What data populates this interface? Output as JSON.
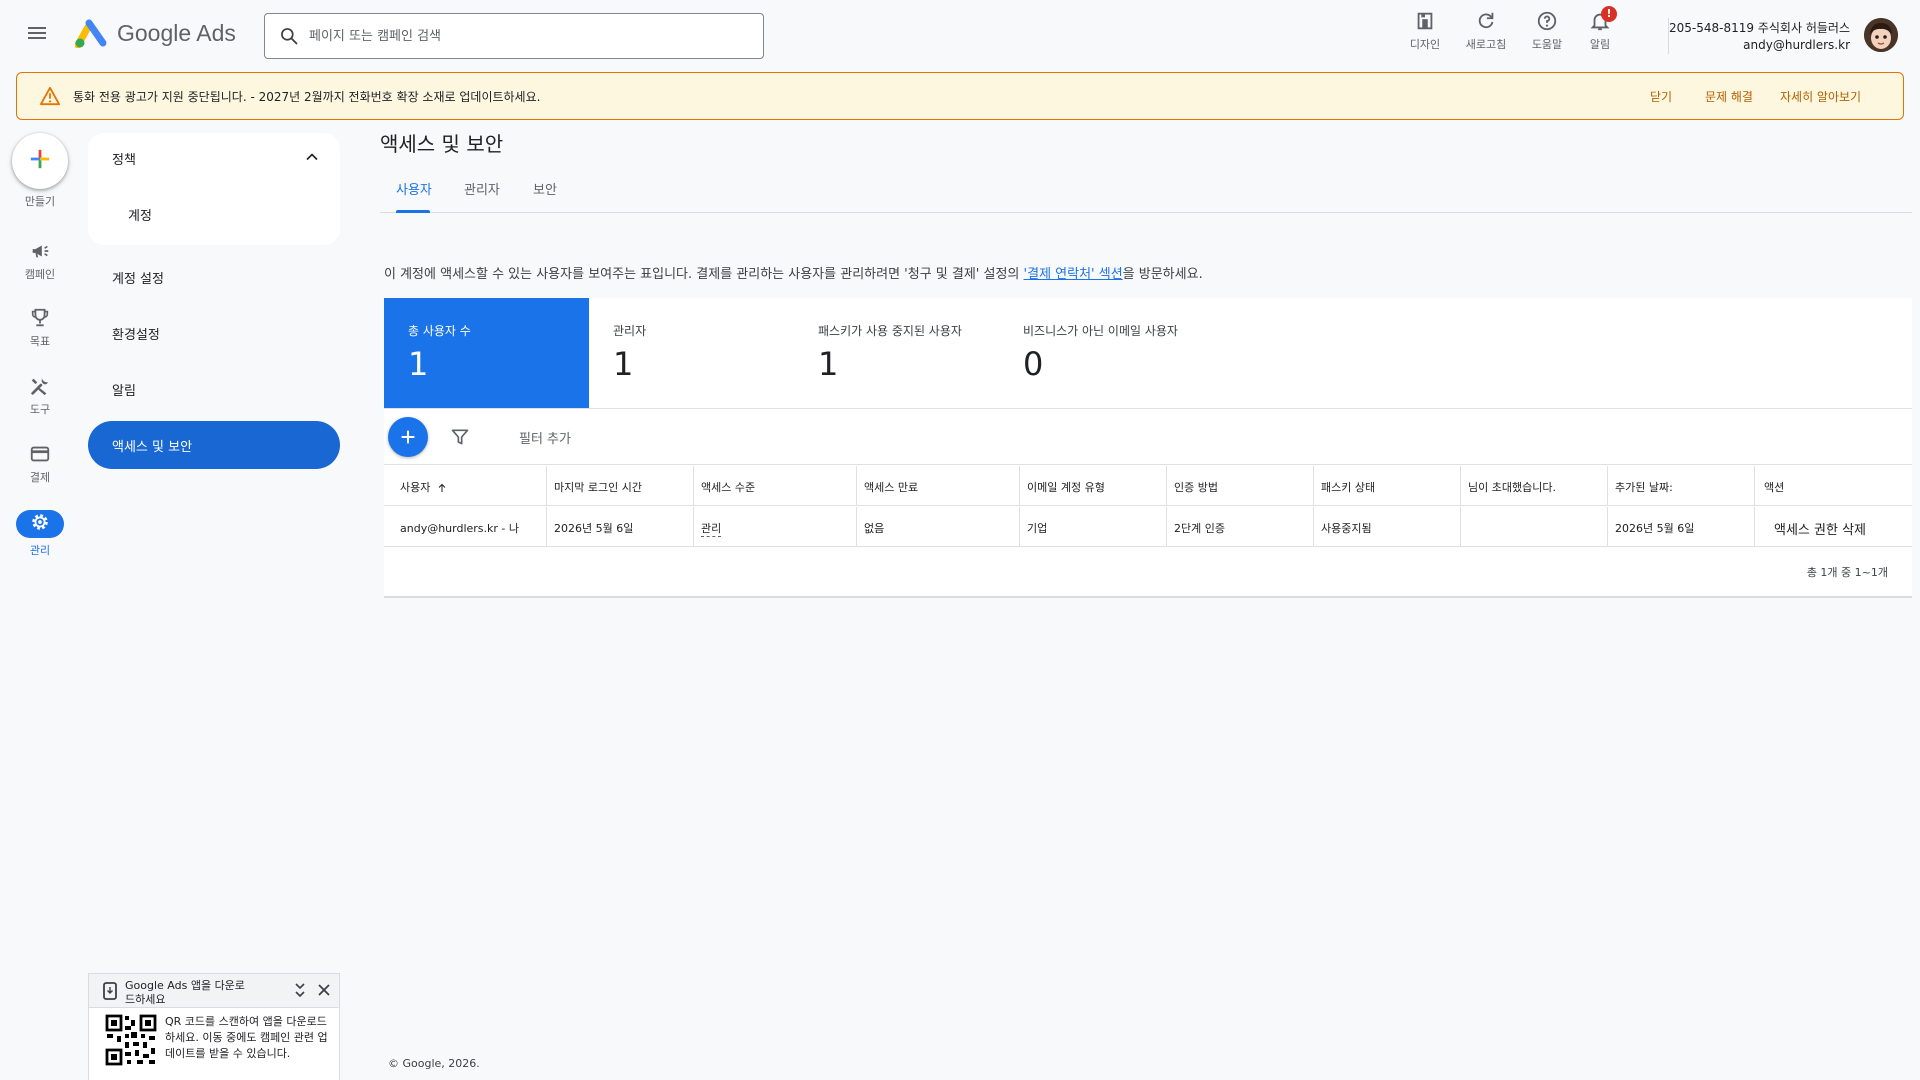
{
  "app": {
    "name": "Google Ads"
  },
  "search": {
    "placeholder": "페이지 또는 캠페인 검색"
  },
  "header_actions": [
    {
      "label": "디자인",
      "icon": "design-icon"
    },
    {
      "label": "새로고침",
      "icon": "refresh-icon"
    },
    {
      "label": "도움말",
      "icon": "help-icon"
    },
    {
      "label": "알림",
      "icon": "bell-icon",
      "badge": "!"
    }
  ],
  "account": {
    "line1": "205-548-8119 주식회사 허들러스",
    "email": "andy@hurdlers.kr"
  },
  "banner": {
    "text": "통화 전용 광고가 지원 중단됩니다. - 2027년 2월까지 전화번호 확장 소재로 업데이트하세요.",
    "actions": [
      "닫기",
      "문제 해결",
      "자세히 알아보기"
    ]
  },
  "rail": [
    {
      "label": "만들기",
      "icon": "plus-icon"
    },
    {
      "label": "캠페인",
      "icon": "megaphone-icon"
    },
    {
      "label": "목표",
      "icon": "trophy-icon"
    },
    {
      "label": "도구",
      "icon": "tools-icon"
    },
    {
      "label": "결제",
      "icon": "credit-card-icon"
    },
    {
      "label": "관리",
      "icon": "gear-icon"
    }
  ],
  "sidenav": {
    "group": "정책",
    "group_child": "계정",
    "items": [
      "계정 설정",
      "환경설정",
      "알림",
      "액세스 및 보안"
    ]
  },
  "page": {
    "title": "액세스 및 보안"
  },
  "tabs": [
    "사용자",
    "관리자",
    "보안"
  ],
  "description": {
    "before": "이 계정에 액세스할 수 있는 사용자를 보여주는 표입니다. 결제를 관리하는 사용자를 관리하려면 '청구 및 결제' 설정의 ",
    "link": "'결제 연락처' 섹션",
    "after": "을 방문하세요."
  },
  "stats": [
    {
      "label": "총 사용자 수",
      "value": "1"
    },
    {
      "label": "관리자",
      "value": "1"
    },
    {
      "label": "패스키가 사용 중지된 사용자",
      "value": "1"
    },
    {
      "label": "비즈니스가 아닌 이메일 사용자",
      "value": "0"
    }
  ],
  "toolbar": {
    "filter_label": "필터 추가"
  },
  "table": {
    "columns": [
      "사용자",
      "마지막 로그인 시간",
      "액세스 수준",
      "액세스 만료",
      "이메일 계정 유형",
      "인증 방법",
      "패스키 상태",
      "님이 초대했습니다.",
      "추가된 날짜:",
      "액션"
    ],
    "rows": [
      [
        "andy@hurdlers.kr - 나",
        "2026년 5월 6일",
        "관리",
        "없음",
        "기업",
        "2단계 인증",
        "사용중지됨",
        "",
        "2026년 5월 6일",
        "액세스 권한 삭제"
      ]
    ],
    "pagination": "총 1개 중 1~1개"
  },
  "qr_popup": {
    "title": "Google Ads 앱을 다운로드하세요",
    "body": "QR 코드를 스캔하여 앱을 다운로드하세요. 이동 중에도 캠페인 관련 업데이트를 받을 수 있습니다."
  },
  "footer": "© Google, 2026."
}
